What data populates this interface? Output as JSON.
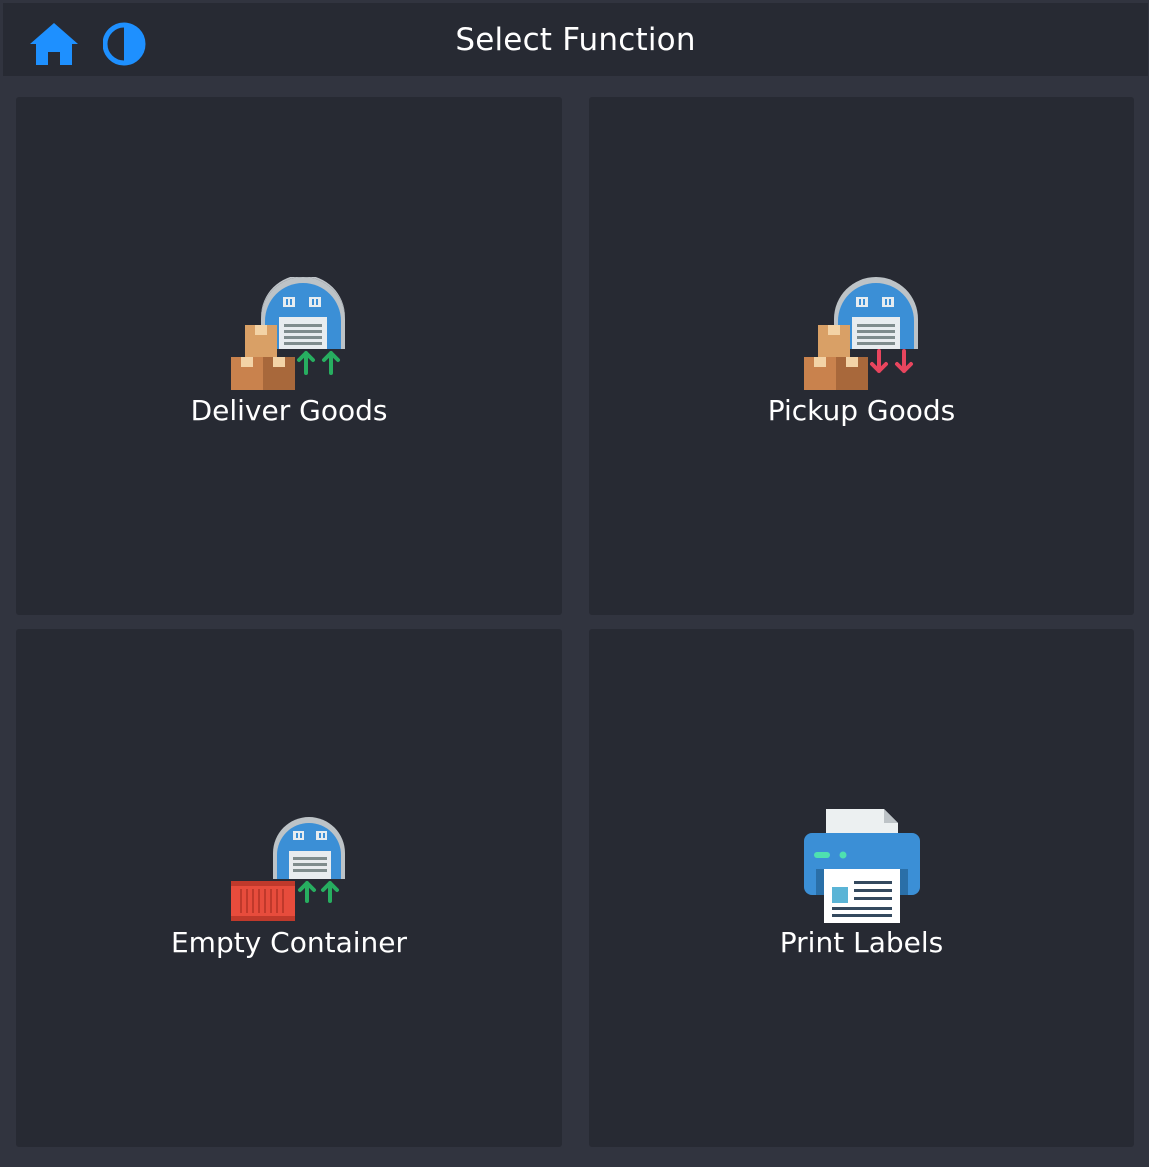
{
  "header": {
    "title": "Select Function",
    "home_icon": "home-icon",
    "theme_icon": "contrast-icon"
  },
  "tiles": [
    {
      "label": "Deliver Goods",
      "icon": "warehouse-deliver-icon"
    },
    {
      "label": "Pickup Goods",
      "icon": "warehouse-pickup-icon"
    },
    {
      "label": "Empty Container",
      "icon": "warehouse-container-icon"
    },
    {
      "label": "Print Labels",
      "icon": "printer-icon"
    }
  ],
  "colors": {
    "background": "#31343f",
    "panel": "#272a33",
    "accent_blue": "#1e90ff",
    "arrow_up": "#27ae60",
    "arrow_down": "#e8455e"
  }
}
